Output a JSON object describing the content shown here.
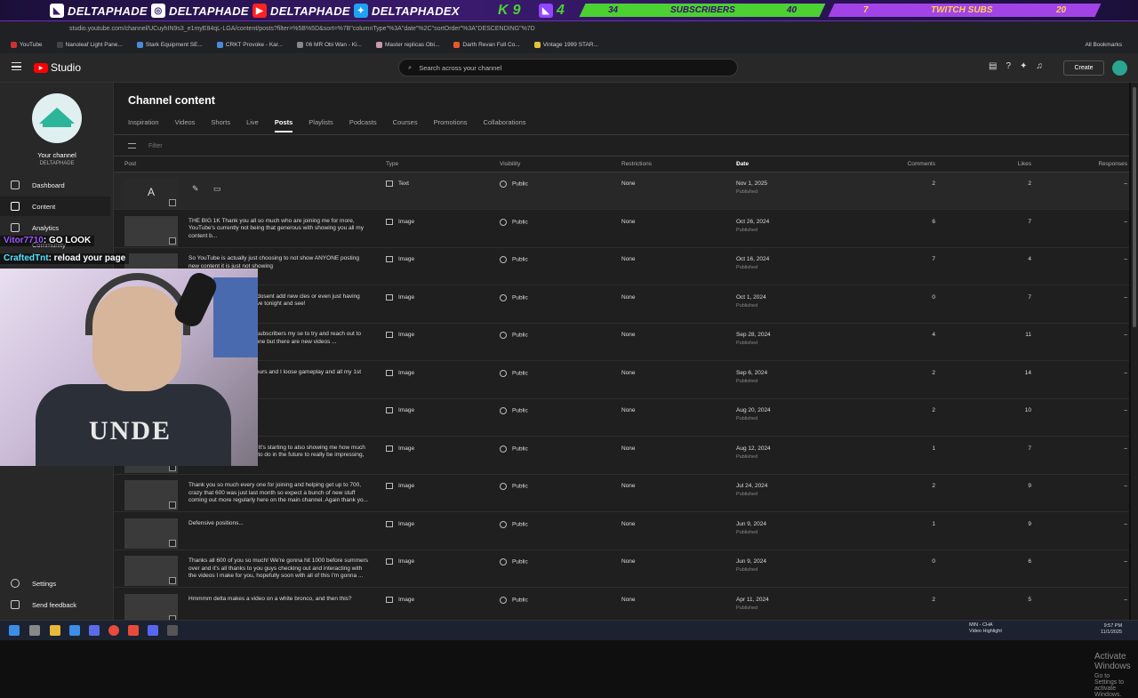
{
  "banner": {
    "handles": [
      "DELTAPHADE",
      "DELTAPHADE",
      "DELTAPHADE",
      "DELTAPHADEX"
    ],
    "counter_left": "K 9",
    "counter_right": "4",
    "subs_bar": {
      "current": "34",
      "label": "SUBSCRIBERS",
      "goal": "40",
      "fraction": 0.85
    },
    "twitch_bar": {
      "current": "7",
      "label": "TWITCH SUBS",
      "goal": "20",
      "fraction": 0.35
    }
  },
  "browser": {
    "url": "studio.youtube.com/channel/UCuyhIN9s3_e1myE84qL-LGA/content/posts?filter=%5B%5D&sort=%7B\"columnType\"%3A\"date\"%2C\"sortOrder\"%3A\"DESCENDING\"%7D",
    "bookmarks": [
      "YouTube",
      "Nanoleaf Light Pane...",
      "Stark Equipment SE...",
      "CRKT Provoke - Kar...",
      "06 MR Obi Wan - Ki...",
      "Master replicas Obi...",
      "Darth Revan Full Co...",
      "Vintage 1999 STAR..."
    ],
    "all_bookmarks": "All Bookmarks"
  },
  "topbar": {
    "studio_label": "Studio",
    "search_placeholder": "Search across your channel",
    "create_label": "Create"
  },
  "sidebar": {
    "your_channel": "Your channel",
    "channel_name": "DELTAPHADE",
    "items": [
      {
        "label": "Dashboard",
        "icon": "dashboard-icon"
      },
      {
        "label": "Content",
        "icon": "content-icon",
        "active": true
      },
      {
        "label": "Analytics",
        "icon": "analytics-icon"
      },
      {
        "label": "Community",
        "icon": "community-icon"
      }
    ],
    "settings": "Settings",
    "feedback": "Send feedback"
  },
  "main": {
    "title": "Channel content",
    "tabs": [
      "Inspiration",
      "Videos",
      "Shorts",
      "Live",
      "Posts",
      "Playlists",
      "Podcasts",
      "Courses",
      "Promotions",
      "Collaborations"
    ],
    "active_tab": "Posts",
    "filter_placeholder": "Filter",
    "columns": {
      "post": "Post",
      "type": "Type",
      "visibility": "Visibility",
      "restrictions": "Restrictions",
      "date": "Date",
      "comments": "Comments",
      "likes": "Likes",
      "responses": "Responses"
    },
    "published_label": "Published",
    "rows": [
      {
        "thumb": "A",
        "text": "",
        "type": "Text",
        "visibility": "Public",
        "restrictions": "None",
        "date": "Nov 1, 2025",
        "comments": "2",
        "likes": "2",
        "responses": "–"
      },
      {
        "thumb": "",
        "text": "THE BIG 1K\nThank you all so much who are joining me for more, YouTube's currently not being that generous with showing you all my content b...",
        "type": "Image",
        "visibility": "Public",
        "restrictions": "None",
        "date": "Oct 26, 2024",
        "comments": "6",
        "likes": "7",
        "responses": "–"
      },
      {
        "thumb": "",
        "text": "So YouTube is actually just choosing to not show ANYONE posting new content it is just not showing",
        "type": "Image",
        "visibility": "Public",
        "restrictions": "None",
        "date": "Oct 16, 2024",
        "comments": "7",
        "likes": "4",
        "responses": "–"
      },
      {
        "thumb": "",
        "text": "isn't jaw dropping and and dosent add new cles or even just having your base with it. Tune in live tonight and see!",
        "type": "Image",
        "visibility": "Public",
        "restrictions": "None",
        "date": "Oct 1, 2024",
        "comments": "0",
        "likes": "7",
        "responses": "–"
      },
      {
        "thumb": "",
        "text": "tirely stopped showing my subscribers my se to try and reach out to everyone when wn to any one but there are new videos ...",
        "type": "Image",
        "visibility": "Public",
        "restrictions": "None",
        "date": "Sep 28, 2024",
        "comments": "4",
        "likes": "11",
        "responses": "–"
      },
      {
        "thumb": "",
        "text": "ave live streams over 12 hours and I loose gameplay and all my 1st impressions on",
        "type": "Image",
        "visibility": "Public",
        "restrictions": "None",
        "date": "Sep 6, 2024",
        "comments": "2",
        "likes": "14",
        "responses": "–"
      },
      {
        "thumb": "",
        "text": "othin but facts",
        "type": "Image",
        "visibility": "Public",
        "restrictions": "None",
        "date": "Aug 20, 2024",
        "comments": "2",
        "likes": "10",
        "responses": "–"
      },
      {
        "thumb": "",
        "text": "ew subscribers this month! It's starting to also showing me how much more work I'm gonna have to do in the future to really be impressing, which I ...",
        "type": "Image",
        "visibility": "Public",
        "restrictions": "None",
        "date": "Aug 12, 2024",
        "comments": "1",
        "likes": "7",
        "responses": "–"
      },
      {
        "thumb": "",
        "text": "Thank you so much every one for joining and helping get up to 700, crazy that 600 was just last month so expect a bunch of new stuff coming out more regularly here on the main channel. Again thank yo...",
        "type": "Image",
        "visibility": "Public",
        "restrictions": "None",
        "date": "Jul 24, 2024",
        "comments": "2",
        "likes": "9",
        "responses": "–"
      },
      {
        "thumb": "",
        "text": "Defensive positions...",
        "type": "Image",
        "visibility": "Public",
        "restrictions": "None",
        "date": "Jun 9, 2024",
        "comments": "1",
        "likes": "9",
        "responses": "–"
      },
      {
        "thumb": "",
        "text": "Thanks all 600 of you so much! We're gonna hit 1000 before summers over and it's all thanks to you guys checking out and interacting with the videos I make for you, hopefully soon with all of this I'm gonna ...",
        "type": "Image",
        "visibility": "Public",
        "restrictions": "None",
        "date": "Jun 9, 2024",
        "comments": "0",
        "likes": "6",
        "responses": "–"
      },
      {
        "thumb": "",
        "text": "Hmmmm delta makes a video on a white bronco, and then this?",
        "type": "Image",
        "visibility": "Public",
        "restrictions": "None",
        "date": "Apr 11, 2024",
        "comments": "2",
        "likes": "5",
        "responses": "–"
      }
    ]
  },
  "overlay": {
    "chat1_user": "Vitor7710",
    "chat1_msg": ": GO LOOK",
    "chat2_user": "CraftedTnt",
    "chat2_msg": ": reload your page",
    "shirt_text": "UNDE"
  },
  "watermark": {
    "line1": "Activate Windows",
    "line2": "Go to Settings to activate Windows."
  },
  "taskbar": {
    "tray_title": "MIN - CHA",
    "tray_sub": "Video Highlight",
    "time": "9:57 PM",
    "date": "11/1/2025"
  },
  "colors": {
    "accent": "#2bb59a",
    "banner_green": "#4bd132",
    "banner_purple": "#a243e8"
  }
}
